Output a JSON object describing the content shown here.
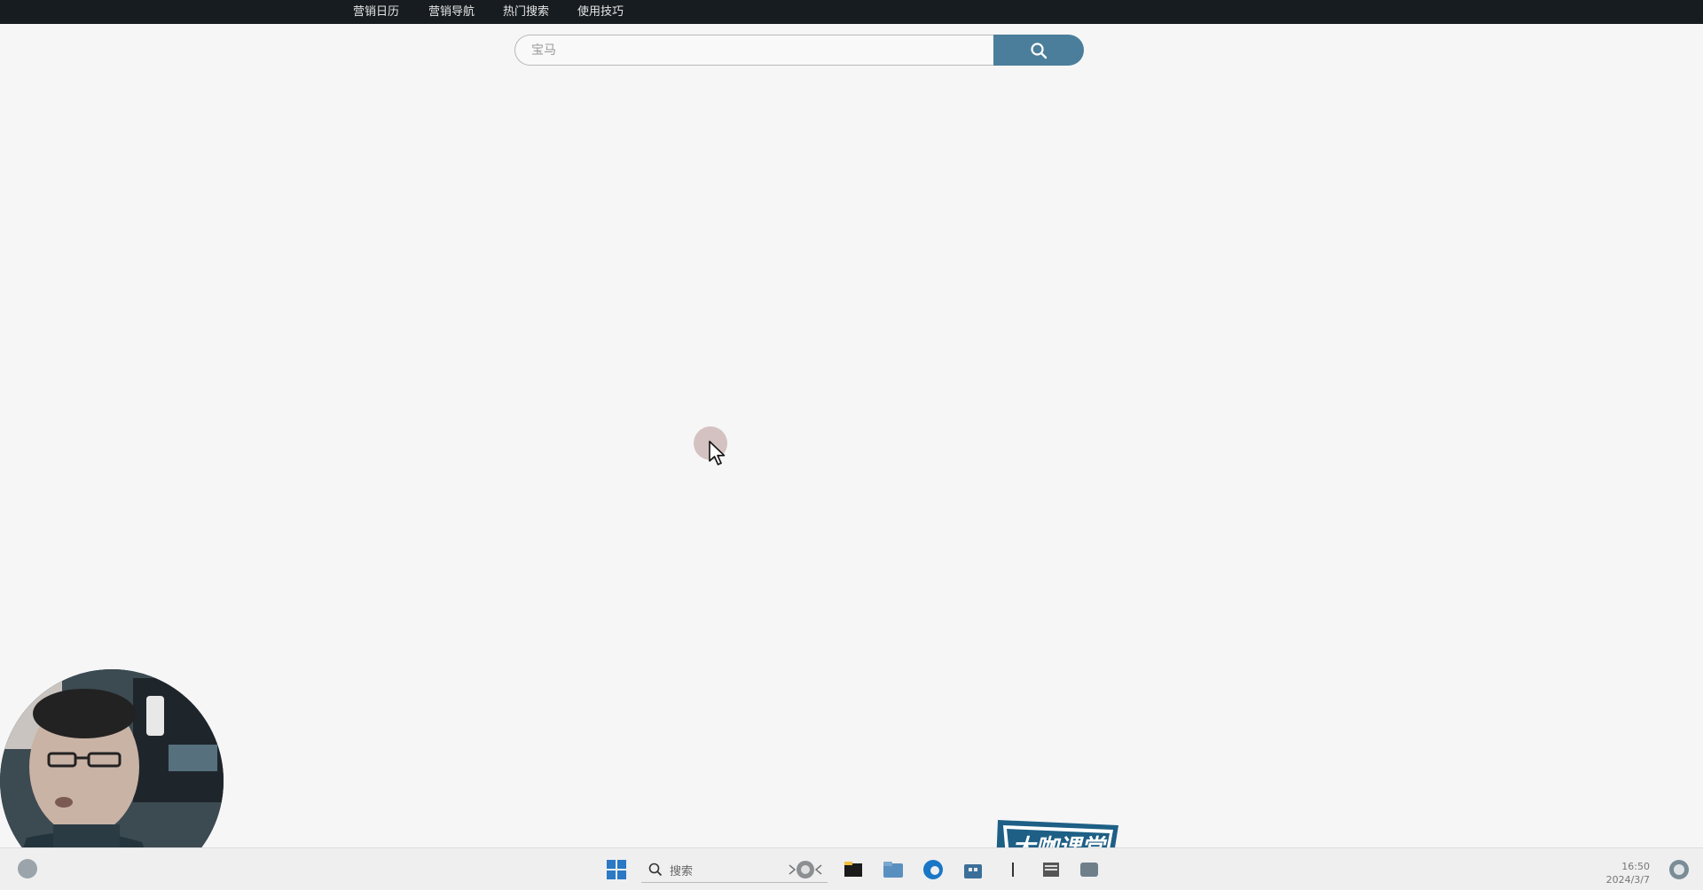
{
  "topnav": {
    "items": [
      {
        "label": "营销日历"
      },
      {
        "label": "营销导航"
      },
      {
        "label": "热门搜索"
      },
      {
        "label": "使用技巧"
      }
    ]
  },
  "search": {
    "value": "",
    "placeholder": "宝马",
    "button_icon": "search-icon"
  },
  "taskbar": {
    "search_label": "搜索",
    "time": "16:50",
    "date": "2024/3/7",
    "icons": [
      "start-icon",
      "search-icon",
      "widget-icon",
      "file-explorer-icon",
      "folder-icon",
      "edge-browser-icon",
      "store-icon",
      "text-app-icon",
      "notepad-icon",
      "app-icon"
    ]
  },
  "watermark": {
    "logo_text": "大咖课堂"
  },
  "colors": {
    "nav_bg": "#171c20",
    "search_button": "#4a7e9b",
    "page_bg": "#f6f6f6"
  }
}
